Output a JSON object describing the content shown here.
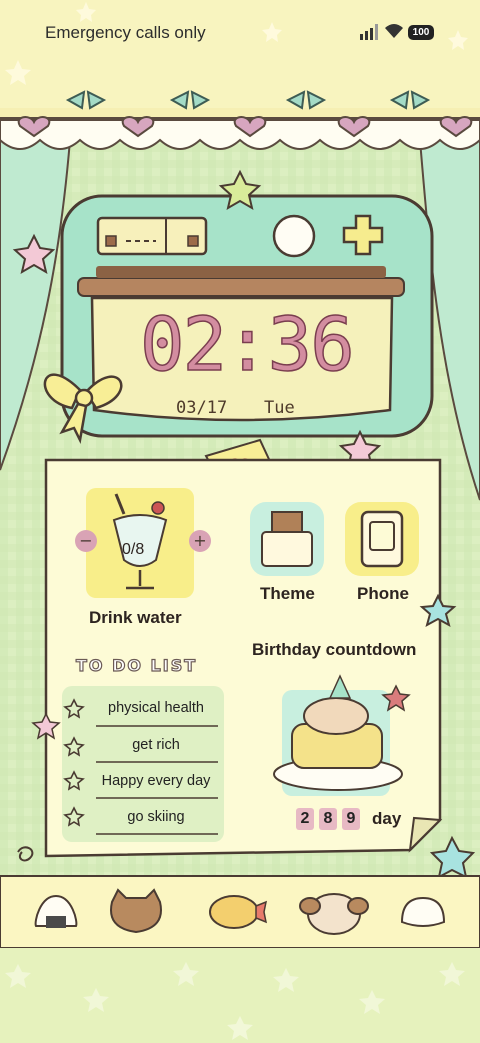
{
  "status_bar": {
    "carrier": "Emergency calls only",
    "battery": "100"
  },
  "clock": {
    "time": "02:36",
    "date": "03/17",
    "day_of_week": "Tue"
  },
  "water_widget": {
    "count": "0/8",
    "minus_label": "−",
    "plus_label": "+",
    "label": "Drink water"
  },
  "apps": {
    "theme": "Theme",
    "phone": "Phone"
  },
  "todo": {
    "title": "TO DO LIST",
    "items": [
      "physical health",
      "get rich",
      "Happy every day",
      "go skiing"
    ]
  },
  "birthday": {
    "title": "Birthday countdown",
    "digits": [
      "2",
      "8",
      "9"
    ],
    "unit": "day"
  },
  "dock": {
    "icons": [
      "onigiri-icon",
      "cat-icon",
      "fried-shrimp-icon",
      "puppy-icon",
      "dumpling-icon"
    ]
  },
  "colors": {
    "background": "#f7f4bd",
    "curtain": "#c7ecd0",
    "tv_body": "#a7e3c9",
    "screen": "#f5f1bb",
    "clock_text": "#d38da0",
    "heart": "#d7a6bf",
    "dock": "#fbf6c2"
  }
}
